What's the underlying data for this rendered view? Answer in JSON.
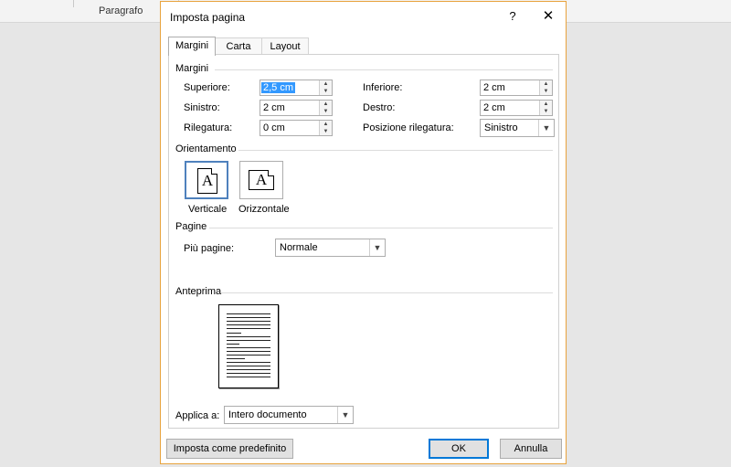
{
  "background": {
    "ribbon_group": "Paragrafo"
  },
  "dialog": {
    "title": "Imposta pagina",
    "help": "?",
    "close": "✕",
    "tabs": [
      "Margini",
      "Carta",
      "Layout"
    ],
    "margins": {
      "section": "Margini",
      "top_label": "Superiore:",
      "top_value": "2,5 cm",
      "bottom_label": "Inferiore:",
      "bottom_value": "2 cm",
      "left_label": "Sinistro:",
      "left_value": "2 cm",
      "right_label": "Destro:",
      "right_value": "2 cm",
      "gutter_label": "Rilegatura:",
      "gutter_value": "0 cm",
      "gutter_pos_label": "Posizione rilegatura:",
      "gutter_pos_value": "Sinistro"
    },
    "orientation": {
      "section": "Orientamento",
      "portrait": "Verticale",
      "landscape": "Orizzontale",
      "glyph": "A"
    },
    "pages": {
      "section": "Pagine",
      "multiple_label": "Più pagine:",
      "multiple_value": "Normale"
    },
    "preview": {
      "section": "Anteprima"
    },
    "apply": {
      "label": "Applica a:",
      "value": "Intero documento"
    },
    "buttons": {
      "default": "Imposta come predefinito",
      "ok": "OK",
      "cancel": "Annulla"
    }
  }
}
